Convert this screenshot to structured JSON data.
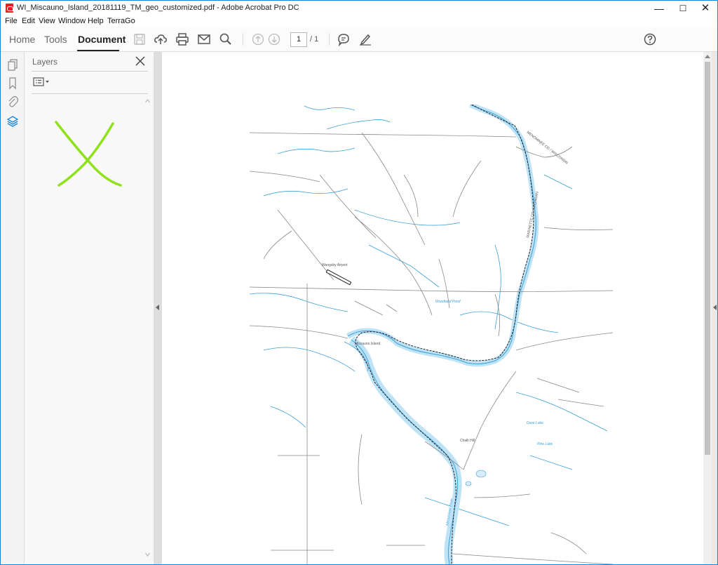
{
  "window": {
    "title": "WI_Miscauno_Island_20181119_TM_geo_customized.pdf - Adobe Acrobat Pro DC",
    "min_glyph": "—",
    "max_glyph": "☐",
    "close_glyph": "✕"
  },
  "menu": [
    "File",
    "Edit",
    "View",
    "Window",
    "Help",
    "TerraGo"
  ],
  "toolbar": {
    "tabs": [
      "Home",
      "Tools",
      "Document"
    ],
    "active_tab": "Document",
    "page_current": "1",
    "page_total": "/ 1"
  },
  "icons": {
    "toolbar": [
      "save-icon",
      "upload-cloud-icon",
      "print-icon",
      "email-icon",
      "search-icon",
      "page-up-icon",
      "page-down-icon",
      "comment-icon",
      "sign-pen-icon",
      "help-icon"
    ],
    "sidebar": [
      "pages-icon",
      "bookmark-icon",
      "attachment-icon",
      "layers-icon"
    ]
  },
  "panel": {
    "title": "Layers",
    "close_glyph": "✕"
  },
  "colors": {
    "accent_border": "#1883d7",
    "annotation_green": "#8fe21a",
    "map_water": "#3aa0d9",
    "map_road": "#888888"
  },
  "map": {
    "labels": {
      "airport": "Wangsby Airport",
      "island": "Miscauno Island",
      "lakes": [
        "Dave Lake",
        "Pine Lake"
      ],
      "pond": "Woodland Pond",
      "place": "Chalk Hill",
      "boundary_upper": "MENOMINEE CO / WISCONSIN",
      "boundary_lower": "MARINETTE CO / MICHIGAN",
      "river": "Menominee River"
    }
  }
}
